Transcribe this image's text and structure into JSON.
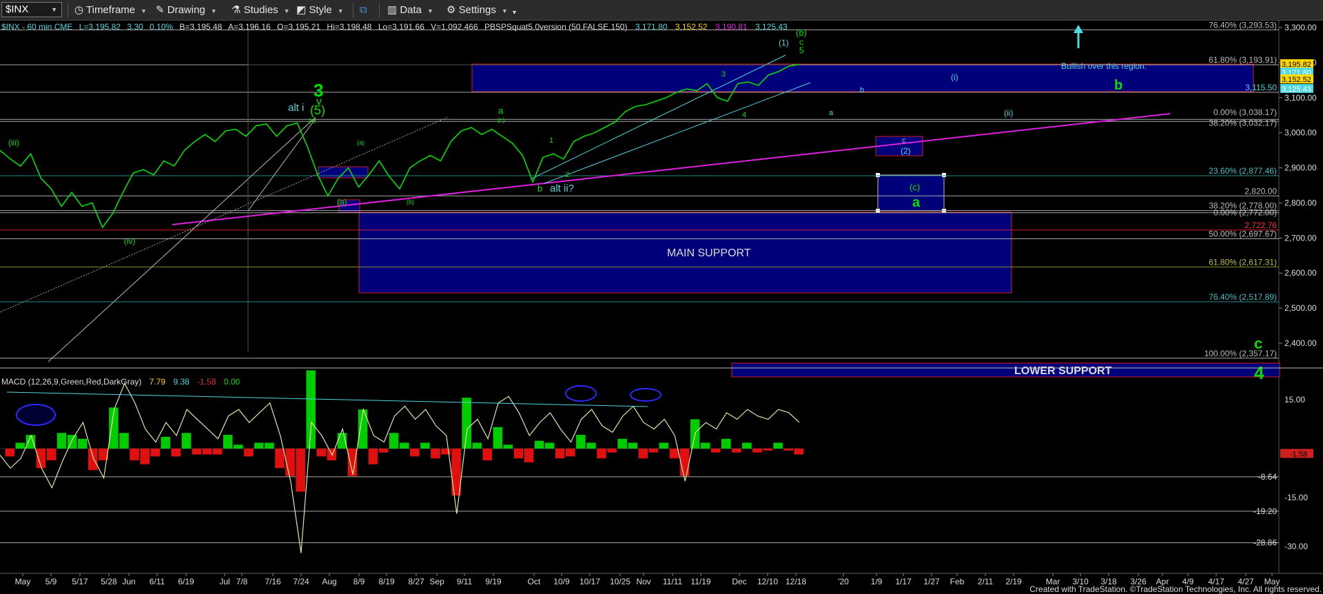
{
  "toolbar": {
    "symbol": "$INX",
    "timeframe": "Timeframe",
    "drawing": "Drawing",
    "studies": "Studies",
    "style": "Style",
    "data": "Data",
    "settings": "Settings"
  },
  "header": {
    "symbol_info": "$INX - 60 min CME",
    "last": "L=3,195.82",
    "change": "3.30",
    "change_pct": "0.10%",
    "bid": "B=3,195.48",
    "ask": "A=3,196.16",
    "open": "O=3,195.21",
    "high": "Hi=3,198.48",
    "low": "Lo=3,191.66",
    "volume": "V=1,092,466",
    "study": "PBSPSquat5.0version (50,FALSE,150)",
    "val1": "3,171.80",
    "val2": "3,152.52",
    "val3": "3,190.81",
    "val4": "3,125.43"
  },
  "colors": {
    "price": "#00e000",
    "cyan": "#4fd8e0",
    "magenta": "#e020e0",
    "box": "#00007a",
    "red": "#d02020"
  },
  "chart_data": {
    "type": "line",
    "title": "$INX - 60 min",
    "ylim": [
      2270,
      3310
    ],
    "price_ticks": [
      "3,300.00",
      "3,200.00",
      "3,100.00",
      "3,000.00",
      "2,900.00",
      "2,800.00",
      "2,700.00",
      "2,600.00",
      "2,500.00",
      "2,400.00"
    ],
    "date_ticks": [
      "May",
      "5/9",
      "5/17",
      "5/28",
      "Jun",
      "6/11",
      "6/19",
      "Jul",
      "7/8",
      "7/16",
      "7/24",
      "Aug",
      "8/9",
      "8/19",
      "8/27",
      "Sep",
      "9/11",
      "9/19",
      "Oct",
      "10/9",
      "10/17",
      "10/25",
      "Nov",
      "11/11",
      "11/19",
      "Dec",
      "12/10",
      "12/18",
      "'20",
      "1/9",
      "1/17",
      "1/27",
      "Feb",
      "2/11",
      "2/19",
      "Mar",
      "3/10",
      "3/18",
      "3/26",
      "Apr",
      "4/9",
      "4/17",
      "4/27",
      "May"
    ],
    "series": [
      {
        "values": [
          2950,
          2925,
          2905,
          2940,
          2870,
          2840,
          2790,
          2830,
          2790,
          2800,
          2730,
          2770,
          2830,
          2885,
          2895,
          2880,
          2920,
          2905,
          2950,
          2975,
          2995,
          2975,
          3005,
          3010,
          2990,
          3020,
          3025,
          2990,
          3020,
          3028,
          2960,
          2880,
          2820,
          2870,
          2900,
          2845,
          2880,
          2920,
          2875,
          2840,
          2900,
          2920,
          2935,
          2920,
          2975,
          3005,
          3015,
          2995,
          3010,
          2990,
          2970,
          2935,
          2860,
          2930,
          2940,
          2925,
          2975,
          2990,
          3000,
          3015,
          3030,
          3060,
          3075,
          3080,
          3090,
          3100,
          3115,
          3125,
          3120,
          3140,
          3100,
          3090,
          3140,
          3145,
          3135,
          3165,
          3175,
          3190,
          3195
        ]
      }
    ],
    "levels": [
      {
        "label": "61.80% (3,193.91)",
        "value": 3193.91
      },
      {
        "label": "3,115.50",
        "value": 3115.5
      },
      {
        "label": "0.00% (3,038.17)",
        "value": 3038.17
      },
      {
        "label": "38.20% (3,032.17)",
        "value": 3032.17
      },
      {
        "label": "23.60% (2,877.46)",
        "value": 2877.46
      },
      {
        "label": "2,820.00",
        "value": 2820
      },
      {
        "label": "38.20% (2,778.00)",
        "value": 2778
      },
      {
        "label": "0.00% (2,772.00)",
        "value": 2772
      },
      {
        "label": "2,722.76",
        "value": 2722.76
      },
      {
        "label": "50.00% (2,697.67)",
        "value": 2697.67
      },
      {
        "label": "61.80% (2,617.31)",
        "value": 2617.31
      },
      {
        "label": "76.40% (2,517.89)",
        "value": 2517.89
      },
      {
        "label": "100.00% (2,357.17)",
        "value": 2357.17
      },
      {
        "label": "76.40% (3,293.53)",
        "value": 3293.53
      }
    ],
    "right_price_tags": [
      "3,195.82",
      "3,171.80",
      "3,152.52",
      "3,125.43"
    ],
    "annotations": {
      "bullish": "Bullish over this region.",
      "main_support": "MAIN SUPPORT",
      "lower_support": "LOWER SUPPORT",
      "b_big": "b",
      "a_big": "a",
      "c_big": "c",
      "four_big": "4",
      "three_big": "3",
      "v_label": "v",
      "five_paren": "(5)",
      "alt_i": "alt i",
      "alt_ii": "alt ii?",
      "i_paren": "(i)",
      "ii_paren": "(ii)",
      "iii_paren": "(iii)",
      "iv_paren": "(iv)",
      "b_paren": "(b)",
      "c_paren": "(c)",
      "a_paren": "(a)",
      "one_paren": "(1)",
      "two_paren": "(2)",
      "c_small": "c",
      "five_small": "5",
      "three_small": "3",
      "four_small": "4",
      "one_small": "1",
      "two_small": "2",
      "a_small": "a",
      "b_small": "b",
      "a_cyan": "a",
      "b_cyan": "b",
      "c_box": "c",
      "v_paren": "(v)",
      "b_paren_small": "(b)",
      "a_paren_small": "(a)",
      "c_paren_small": "(c)"
    },
    "macd": {
      "label": "MACD (12,26,9,Green,Red,DarkGray)",
      "v1": "7.79",
      "v2": "9.38",
      "v3": "-1.58",
      "v4": "0.00",
      "ticks": [
        "15.00",
        "-15.00",
        "-30.00"
      ],
      "levels": [
        "-8.64",
        "-19.20",
        "-28.86"
      ],
      "current": "-1.58",
      "ylim": [
        -35,
        22
      ],
      "values": [
        -2,
        -6,
        -3,
        4,
        -6,
        -12,
        -4,
        3,
        8,
        -3,
        -9,
        12,
        20,
        14,
        6,
        2,
        8,
        4,
        12,
        9,
        6,
        3,
        10,
        12,
        8,
        11,
        14,
        4,
        -10,
        -32,
        8,
        4,
        -2,
        6,
        -8,
        12,
        4,
        2,
        10,
        13,
        9,
        12,
        7,
        4,
        -20,
        6,
        9,
        3,
        14,
        16,
        11,
        4,
        8,
        11,
        6,
        2,
        9,
        12,
        7,
        5,
        10,
        13,
        8,
        6,
        9,
        4,
        -10,
        5,
        8,
        6,
        11,
        9,
        12,
        10,
        9,
        12,
        11,
        8
      ]
    }
  },
  "footer": "Created with TradeStation. ©TradeStation Technologies, Inc. All rights reserved."
}
